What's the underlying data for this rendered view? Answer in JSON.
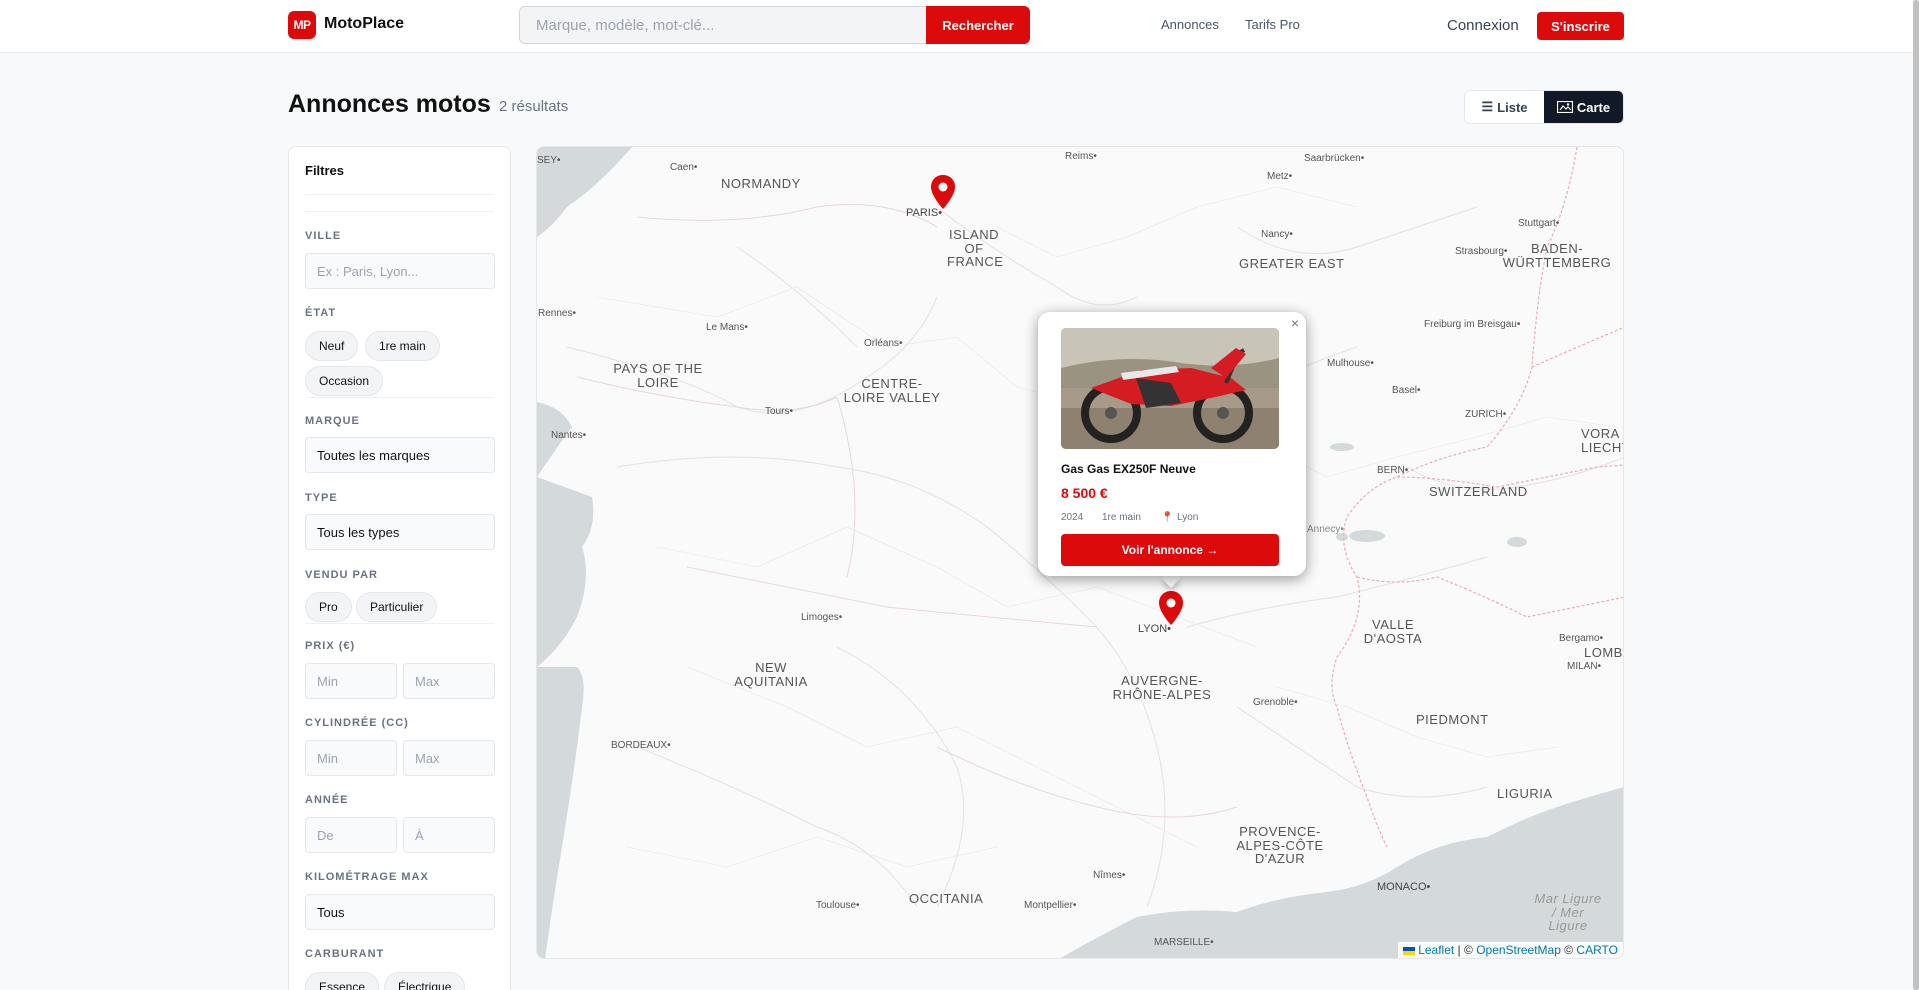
{
  "header": {
    "logo_mark": "MP",
    "brand": "MotoPlace",
    "search_placeholder": "Marque, modèle, mot-clé...",
    "search_button": "Rechercher",
    "nav": [
      "Annonces",
      "Tarifs Pro"
    ],
    "login": "Connexion",
    "signup": "S'inscrire"
  },
  "page": {
    "title": "Annonces motos",
    "count": "2 résultats",
    "view_list": "Liste",
    "view_map": "Carte",
    "view_list_icon": "list-icon",
    "view_map_icon": "map-icon",
    "active_view": "Carte"
  },
  "filters": {
    "title": "Filtres",
    "city": {
      "label": "VILLE",
      "placeholder": "Ex : Paris, Lyon..."
    },
    "condition": {
      "label": "ÉTAT",
      "options": [
        "Neuf",
        "1re main",
        "Occasion"
      ]
    },
    "brand": {
      "label": "MARQUE",
      "value": "Toutes les marques"
    },
    "type": {
      "label": "TYPE",
      "value": "Tous les types"
    },
    "seller": {
      "label": "VENDU PAR",
      "options": [
        "Pro",
        "Particulier"
      ]
    },
    "price": {
      "label": "PRIX (€)",
      "min": "Min",
      "max": "Max"
    },
    "cc": {
      "label": "CYLINDRÉE (CC)",
      "min": "Min",
      "max": "Max"
    },
    "year": {
      "label": "ANNÉE",
      "min": "De",
      "max": "À"
    },
    "km": {
      "label": "KILOMÉTRAGE MAX",
      "value": "Tous"
    },
    "fuel": {
      "label": "CARBURANT",
      "options": [
        "Essence",
        "Électrique"
      ]
    }
  },
  "map": {
    "cities": [
      "SEY",
      "Caen",
      "Reims",
      "Saarbrücken",
      "Metz",
      "PARIS",
      "Nancy",
      "Stuttgart",
      "Strasbourg",
      "Rennes",
      "Le Mans",
      "Orléans",
      "Freiburg im Breisgau",
      "Mulhouse",
      "Basel",
      "Tours",
      "ZURICH",
      "Nantes",
      "BERN",
      "Annecy",
      "Limoges",
      "LYON",
      "Bergamo",
      "MILAN",
      "Grenoble",
      "BORDEAUX",
      "Nîmes",
      "Montpellier",
      "Toulouse",
      "MARSEILLE",
      "MONACO"
    ],
    "regions": [
      "NORMANDY",
      "ISLAND OF FRANCE",
      "GREATER EAST",
      "BADEN-WÜRTTEMBERG",
      "PAYS OF THE LOIRE",
      "CENTRE-LOIRE VALLEY",
      "SWITZERLAND",
      "VORA LIECHTENS",
      "VALLE D'AOSTA",
      "LOMB",
      "NEW AQUITANIA",
      "AUVERGNE-RHÔNE-ALPES",
      "PIEDMONT",
      "LIGURIA",
      "PROVENCE-ALPES-CÔTE D'AZUR",
      "OCCITANIA",
      "Mar Ligure / Mer Ligure"
    ],
    "attribution": {
      "leaflet": "Leaflet",
      "sep": " | © ",
      "osm": "OpenStreetMap",
      "carto_prefix": " © ",
      "carto": "CARTO"
    },
    "markers": [
      {
        "city": "Paris",
        "color": "#dc0a0a"
      },
      {
        "city": "Lyon",
        "color": "#dc0a0a"
      }
    ]
  },
  "popup": {
    "close": "×",
    "title": "Gas Gas EX250F Neuve",
    "price": "8 500 €",
    "year": "2024",
    "condition": "1re main",
    "location_icon": "pin-icon",
    "location": "Lyon",
    "cta": "Voir l'annonce →"
  },
  "colors": {
    "accent": "#dc0a0a",
    "dark": "#111827",
    "map_bg": "#fafafa",
    "border_red": "#e8b4b8"
  }
}
